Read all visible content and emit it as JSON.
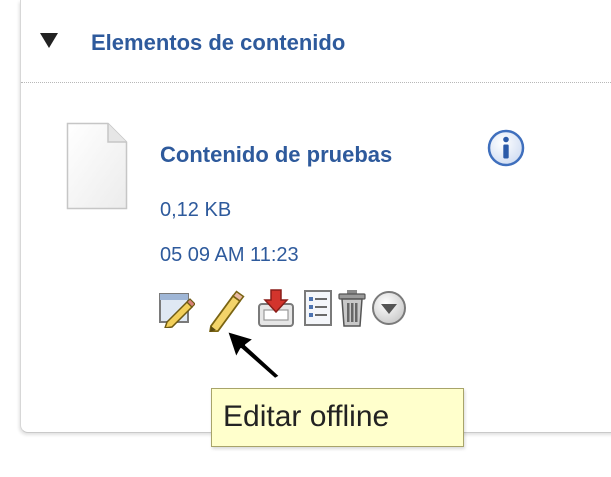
{
  "panel": {
    "title": "Elementos de contenido"
  },
  "item": {
    "title": "Contenido de pruebas",
    "size": "0,12 KB",
    "date": "05 09 AM 11:23"
  },
  "actions": [
    {
      "icon": "edit-properties-icon"
    },
    {
      "icon": "pencil-icon"
    },
    {
      "icon": "download-tray-icon"
    },
    {
      "icon": "details-list-icon"
    },
    {
      "icon": "trash-icon"
    },
    {
      "icon": "more-actions-icon"
    }
  ],
  "tooltip": {
    "text": "Editar offline"
  },
  "colors": {
    "link": "#2e5a9c",
    "tooltip_bg": "#ffffcc",
    "tooltip_border": "#a8a46a"
  }
}
